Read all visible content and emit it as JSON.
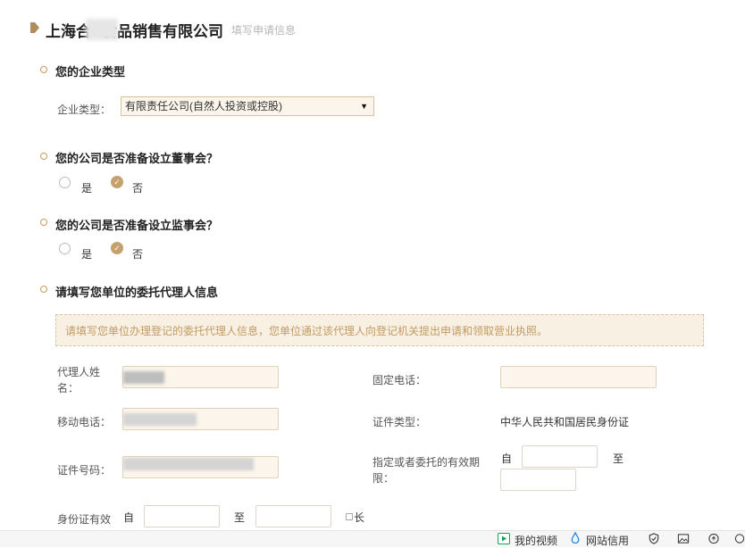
{
  "header": {
    "title_prefix": "上海合",
    "title_suffix": "食品销售有限公司",
    "subtitle": "填写申请信息"
  },
  "sections": {
    "enterprise_type": {
      "title": "您的企业类型",
      "label": "企业类型：",
      "selected": "有限责任公司(自然人投资或控股)"
    },
    "board": {
      "title": "您的公司是否准备设立董事会？",
      "option_yes": "是",
      "option_no": "否",
      "selected": "否"
    },
    "supervisors": {
      "title": "您的公司是否准备设立监事会？",
      "option_yes": "是",
      "option_no": "否",
      "selected": "否"
    },
    "agent": {
      "title": "请填写您单位的委托代理人信息",
      "notice": "请填写您单位办理登记的委托代理人信息，您单位通过该代理人向登记机关提出申请和领取营业执照。",
      "name_label_1": "代理人姓",
      "name_label_2": "名：",
      "landline_label": "固定电话：",
      "mobile_label": "移动电话：",
      "id_type_label": "证件类型：",
      "id_type_value": "中华人民共和国居民身份证",
      "id_number_label": "证件号码：",
      "validity_label_1": "指定或者委托的有效期",
      "validity_label_2": "限：",
      "from": "自",
      "to": "至",
      "id_validity_label": "身份证有效",
      "long_term": "长"
    }
  },
  "bottom_bar": {
    "video": "我的视频",
    "credit": "网站信用"
  },
  "colors": {
    "accent": "#c4a16d",
    "notice_bg": "#f8f0e2",
    "input_bg": "#fbf5eb"
  }
}
